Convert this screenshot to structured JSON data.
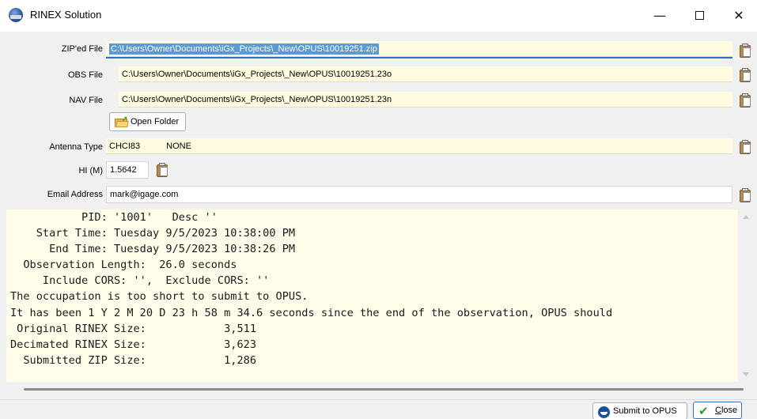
{
  "window": {
    "title": "RINEX Solution",
    "minimize_glyph": "—",
    "close_glyph": "✕"
  },
  "form": {
    "zip_label": "ZIP'ed File",
    "zip_value": "C:\\Users\\Owner\\Documents\\iGx_Projects\\_New\\OPUS\\10019251.zip",
    "obs_label": "OBS File",
    "obs_value": "C:\\Users\\Owner\\Documents\\iGx_Projects\\_New\\OPUS\\10019251.23o",
    "nav_label": "NAV File",
    "nav_value": "C:\\Users\\Owner\\Documents\\iGx_Projects\\_New\\OPUS\\10019251.23n",
    "open_folder_label": "Open Folder",
    "antenna_label": "Antenna Type",
    "antenna_model": "CHCI83",
    "antenna_radome": "NONE",
    "hi_label": "HI (M)",
    "hi_value": "1.5642",
    "email_label": "Email Address",
    "email_value": "mark@igage.com"
  },
  "report": {
    "lines": [
      "           PID: '1001'   Desc ''",
      "    Start Time: Tuesday 9/5/2023 10:38:00 PM",
      "      End Time: Tuesday 9/5/2023 10:38:26 PM",
      "  Observation Length:  26.0 seconds",
      "     Include CORS: '',  Exclude CORS: ''",
      "The occupation is too short to submit to OPUS.",
      "It has been 1 Y 2 M 20 D 23 h 58 m 34.6 seconds since the end of the observation, OPUS should",
      " Original RINEX Size:            3,511",
      "Decimated RINEX Size:            3,623",
      "  Submitted ZIP Size:            1,286"
    ]
  },
  "buttons": {
    "submit_label": "Submit to OPUS",
    "close_label_first": "C",
    "close_label_rest": "lose"
  },
  "colors": {
    "field_bg": "#fffbe0",
    "report_bg": "#fffdea",
    "selection": "#5b9bd5",
    "focus": "#2e6fd0"
  },
  "icons": [
    "app-icon",
    "paste-icon",
    "folder-open-icon",
    "noaa-icon",
    "checkmark-icon"
  ]
}
